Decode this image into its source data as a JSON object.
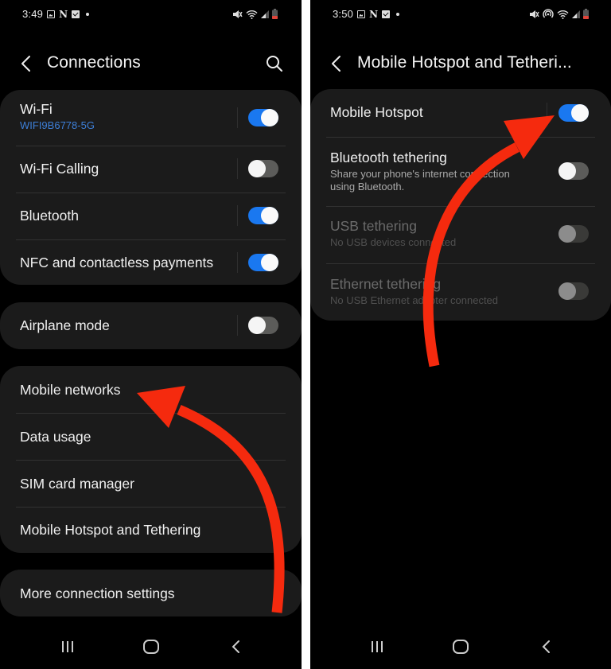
{
  "colors": {
    "accent_blue": "#1a78f0",
    "wifi_ssid_blue": "#3d7fd8",
    "annotation_red": "#f52a0e",
    "card_bg": "#1b1b1b",
    "screen_bg": "#000000"
  },
  "left_screen": {
    "status_bar": {
      "time": "3:49",
      "left_icons": [
        "gallery-icon",
        "netflix-n-icon",
        "checkbox-icon",
        "dot-icon"
      ],
      "right_icons": [
        "mute-icon",
        "wifi-icon",
        "signal-icon",
        "battery-low-icon"
      ]
    },
    "header": {
      "back_icon": "chevron-left-icon",
      "title": "Connections",
      "search_icon": "search-icon"
    },
    "groups": [
      {
        "items": [
          {
            "label": "Wi-Fi",
            "sublabel": "WIFI9B6778-5G",
            "toggle": "on"
          },
          {
            "label": "Wi-Fi Calling",
            "toggle": "off"
          },
          {
            "label": "Bluetooth",
            "toggle": "on"
          },
          {
            "label": "NFC and contactless payments",
            "toggle": "on"
          }
        ]
      },
      {
        "items": [
          {
            "label": "Airplane mode",
            "toggle": "off"
          }
        ]
      },
      {
        "items": [
          {
            "label": "Mobile networks"
          },
          {
            "label": "Data usage"
          },
          {
            "label": "SIM card manager"
          },
          {
            "label": "Mobile Hotspot and Tethering"
          }
        ]
      },
      {
        "items": [
          {
            "label": "More connection settings"
          }
        ]
      }
    ],
    "navbar": [
      "recent-apps-icon",
      "home-icon",
      "back-icon"
    ],
    "annotation": "red curved arrow pointing to Mobile networks"
  },
  "right_screen": {
    "status_bar": {
      "time": "3:50",
      "left_icons": [
        "gallery-icon",
        "netflix-n-icon",
        "checkbox-icon",
        "dot-icon"
      ],
      "right_icons": [
        "mute-icon",
        "hotspot-icon",
        "wifi-icon",
        "signal-icon",
        "battery-low-icon"
      ]
    },
    "header": {
      "back_icon": "chevron-left-icon",
      "title": "Mobile Hotspot and Tetheri..."
    },
    "items": [
      {
        "label": "Mobile Hotspot",
        "toggle": "on",
        "enabled": true
      },
      {
        "label": "Bluetooth tethering",
        "description": "Share your phone's internet connection using Bluetooth.",
        "toggle": "off",
        "enabled": true
      },
      {
        "label": "USB tethering",
        "description": "No USB devices connected",
        "toggle": "off",
        "enabled": false
      },
      {
        "label": "Ethernet tethering",
        "description": "No USB Ethernet adapter connected",
        "toggle": "off",
        "enabled": false
      }
    ],
    "navbar": [
      "recent-apps-icon",
      "home-icon",
      "back-icon"
    ],
    "annotation": "red curved arrow pointing to Mobile Hotspot toggle"
  }
}
